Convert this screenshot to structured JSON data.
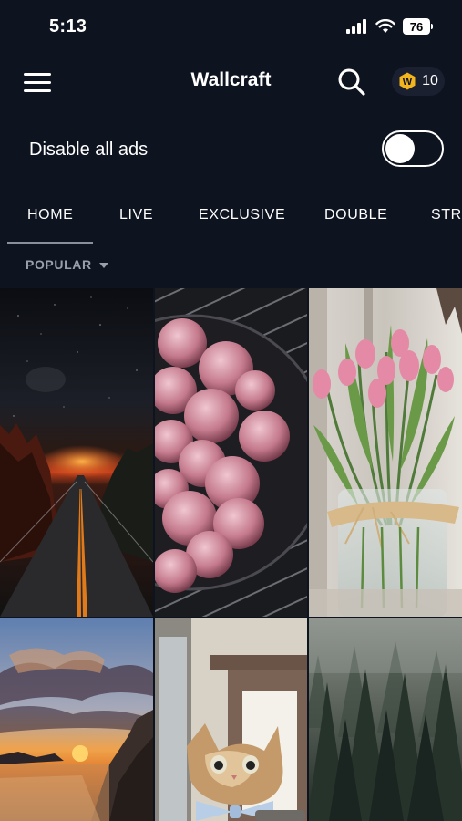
{
  "status_bar": {
    "time": "5:13",
    "battery": "76"
  },
  "app_bar": {
    "title": "Wallcraft",
    "coins": "10",
    "coin_letter": "W",
    "accent": "#f2b51e"
  },
  "ads": {
    "label": "Disable all ads",
    "enabled": false
  },
  "tabs": [
    {
      "label": "HOME",
      "active": true
    },
    {
      "label": "LIVE"
    },
    {
      "label": "EXCLUSIVE"
    },
    {
      "label": "DOUBLE"
    },
    {
      "label": "STR"
    }
  ],
  "sort": {
    "label": "POPULAR"
  },
  "wallpapers": [
    {
      "name": "night-road-sunset-wallpaper"
    },
    {
      "name": "raspberries-bowl-wallpaper"
    },
    {
      "name": "pink-tulips-vase-wallpaper"
    },
    {
      "name": "coastal-sunset-wallpaper"
    },
    {
      "name": "cat-with-bow-tie-wallpaper"
    },
    {
      "name": "foggy-forest-wallpaper"
    }
  ]
}
